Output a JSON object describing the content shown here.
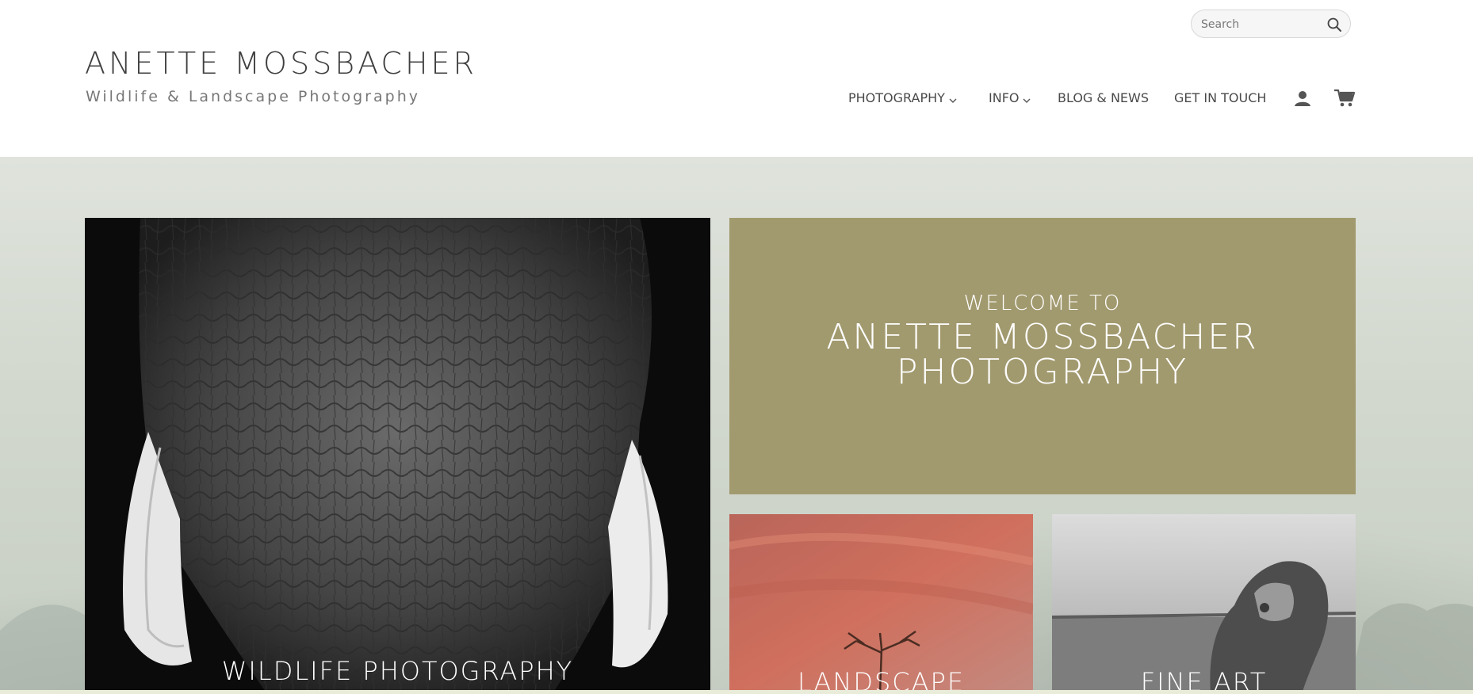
{
  "search": {
    "placeholder": "Search"
  },
  "brand": {
    "title": "ANETTE MOSSBACHER",
    "subtitle": "Wildlife & Landscape Photography"
  },
  "nav": {
    "items": [
      {
        "label": "PHOTOGRAPHY",
        "has_dropdown": true
      },
      {
        "label": "INFO",
        "has_dropdown": true
      },
      {
        "label": "BLOG & NEWS",
        "has_dropdown": false
      },
      {
        "label": "GET IN TOUCH",
        "has_dropdown": false
      }
    ],
    "icons": [
      "user-icon",
      "cart-icon"
    ]
  },
  "welcome": {
    "line1": "WELCOME TO",
    "line2": "ANETTE MOSSBACHER PHOTOGRAPHY"
  },
  "tiles": {
    "wildlife": "WILDLIFE PHOTOGRAPHY",
    "landscape": "LANDSCAPE",
    "fineart": "FINE ART"
  },
  "colors": {
    "welcome_bg": "#a29a6f",
    "text_dark": "#3f3f3f",
    "nav_text": "#4a4a4a"
  }
}
